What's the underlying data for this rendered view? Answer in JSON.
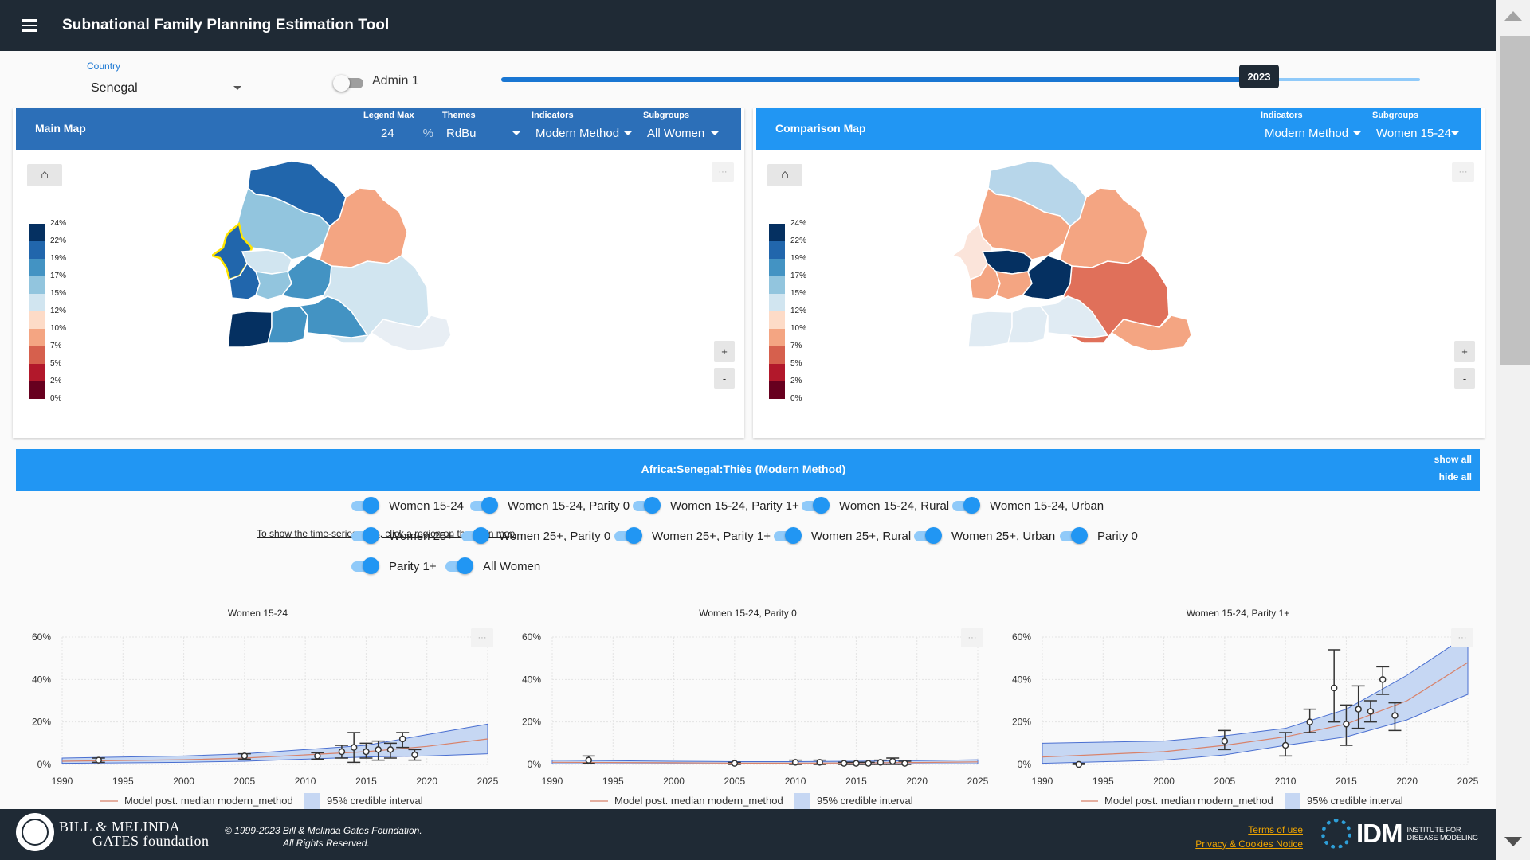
{
  "app": {
    "title": "Subnational Family Planning Estimation Tool"
  },
  "controls": {
    "country_label": "Country",
    "country_value": "Senegal",
    "admin_label": "Admin 1",
    "admin_on": false,
    "year": 2023,
    "year_label": "2023",
    "year_min": 1990,
    "year_max": 2030
  },
  "main_map": {
    "title": "Main Map",
    "legend_max_label": "Legend Max",
    "legend_max_value": "24",
    "legend_max_unit": "%",
    "themes_label": "Themes",
    "themes_value": "RdBu",
    "indicators_label": "Indicators",
    "indicators_value": "Modern Method",
    "subgroups_label": "Subgroups",
    "subgroups_value": "All Women",
    "note": "To show the time-series plots, click a region on the main map"
  },
  "comparison_map": {
    "title": "Comparison Map",
    "indicators_label": "Indicators",
    "indicators_value": "Modern Method",
    "subgroups_label": "Subgroups",
    "subgroups_value": "Women 15-24"
  },
  "legend": {
    "labels": [
      "24%",
      "22%",
      "19%",
      "17%",
      "15%",
      "12%",
      "10%",
      "7%",
      "5%",
      "2%",
      "0%"
    ],
    "colors": [
      "#053061",
      "#2166ac",
      "#4393c3",
      "#92c5de",
      "#d1e5f0",
      "#fddbc7",
      "#f4a582",
      "#d6604d",
      "#b2182b",
      "#67001f"
    ]
  },
  "map_buttons": {
    "home": "⌂",
    "dots": "···",
    "zoom_in": "+",
    "zoom_out": "-"
  },
  "region": {
    "title": "Africa:Senegal:Thiès (Modern Method)",
    "show_all": "show all",
    "hide_all": "hide all"
  },
  "subgroup_toggles": [
    "Women 15-24",
    "Women 15-24, Parity 0",
    "Women 15-24, Parity 1+",
    "Women 15-24, Rural",
    "Women 15-24, Urban",
    "Women 25+",
    "Women 25+, Parity 0",
    "Women 25+, Parity 1+",
    "Women 25+, Rural",
    "Women 25+, Urban",
    "Parity 0",
    "Parity 1+",
    "All Women"
  ],
  "chart_data": [
    {
      "type": "line",
      "title": "Women 15-24",
      "x_ticks": [
        "1990",
        "1995",
        "2000",
        "2005",
        "2010",
        "2015",
        "2020",
        "2025"
      ],
      "y_ticks": [
        "0%",
        "20%",
        "40%",
        "60%"
      ],
      "xlim": [
        1990,
        2025
      ],
      "ylim": [
        0,
        60
      ],
      "legend": {
        "median": "Model post. median modern_method",
        "interval": "95% credible interval"
      },
      "median": [
        [
          1990,
          1.5
        ],
        [
          2000,
          2.2
        ],
        [
          2005,
          3
        ],
        [
          2010,
          4.5
        ],
        [
          2015,
          6
        ],
        [
          2020,
          8.5
        ],
        [
          2025,
          12
        ]
      ],
      "interval": [
        [
          1990,
          0.5,
          3
        ],
        [
          2000,
          1,
          4
        ],
        [
          2005,
          1.5,
          5
        ],
        [
          2010,
          2.5,
          7
        ],
        [
          2015,
          3.5,
          9
        ],
        [
          2020,
          4,
          14
        ],
        [
          2025,
          5,
          19
        ]
      ],
      "observations": [
        [
          1993,
          2,
          1,
          3
        ],
        [
          2005,
          4,
          2.5,
          5
        ],
        [
          2011,
          4,
          2.5,
          5.5
        ],
        [
          2013,
          6,
          3,
          9
        ],
        [
          2014,
          8,
          1,
          15
        ],
        [
          2015,
          6,
          3,
          10
        ],
        [
          2016,
          7,
          2,
          11
        ],
        [
          2017,
          7,
          3,
          10
        ],
        [
          2018,
          12,
          8,
          15
        ],
        [
          2019,
          4.5,
          2,
          7
        ]
      ]
    },
    {
      "type": "line",
      "title": "Women 15-24, Parity 0",
      "x_ticks": [
        "1990",
        "1995",
        "2000",
        "2005",
        "2010",
        "2015",
        "2020",
        "2025"
      ],
      "y_ticks": [
        "0%",
        "20%",
        "40%",
        "60%"
      ],
      "xlim": [
        1990,
        2025
      ],
      "ylim": [
        0,
        60
      ],
      "legend": {
        "median": "Model post. median modern_method",
        "interval": "95% credible interval"
      },
      "median": [
        [
          1990,
          1
        ],
        [
          2000,
          0.8
        ],
        [
          2005,
          0.6
        ],
        [
          2010,
          0.6
        ],
        [
          2015,
          0.7
        ],
        [
          2020,
          0.9
        ],
        [
          2025,
          1.2
        ]
      ],
      "interval": [
        [
          1990,
          0.3,
          2
        ],
        [
          2000,
          0.3,
          1.5
        ],
        [
          2005,
          0.2,
          1.3
        ],
        [
          2010,
          0.2,
          1.3
        ],
        [
          2015,
          0.2,
          1.5
        ],
        [
          2020,
          0.3,
          1.8
        ],
        [
          2025,
          0.3,
          2.2
        ]
      ],
      "observations": [
        [
          1993,
          2,
          0.5,
          4
        ],
        [
          2005,
          0.5,
          0,
          1
        ],
        [
          2010,
          1,
          0,
          2
        ],
        [
          2012,
          1,
          0,
          2
        ],
        [
          2014,
          0.5,
          0,
          1
        ],
        [
          2015,
          0.5,
          0,
          1
        ],
        [
          2016,
          0.5,
          0,
          1
        ],
        [
          2017,
          1,
          0,
          2
        ],
        [
          2018,
          1.5,
          0,
          3
        ],
        [
          2019,
          0.5,
          0,
          1.5
        ]
      ]
    },
    {
      "type": "line",
      "title": "Women 15-24, Parity 1+",
      "x_ticks": [
        "1990",
        "1995",
        "2000",
        "2005",
        "2010",
        "2015",
        "2020",
        "2025"
      ],
      "y_ticks": [
        "0%",
        "20%",
        "40%",
        "60%"
      ],
      "xlim": [
        1990,
        2025
      ],
      "ylim": [
        0,
        60
      ],
      "legend": {
        "median": "Model post. median modern_method",
        "interval": "95% credible interval"
      },
      "median": [
        [
          1990,
          3.5
        ],
        [
          2000,
          6
        ],
        [
          2005,
          9
        ],
        [
          2010,
          13
        ],
        [
          2015,
          19
        ],
        [
          2020,
          30
        ],
        [
          2025,
          48
        ]
      ],
      "interval": [
        [
          1990,
          0.5,
          10
        ],
        [
          2000,
          2,
          11
        ],
        [
          2005,
          4.5,
          13.5
        ],
        [
          2010,
          9,
          17
        ],
        [
          2015,
          13,
          26
        ],
        [
          2020,
          21,
          42
        ],
        [
          2025,
          33,
          61
        ]
      ],
      "observations": [
        [
          1993,
          0,
          0,
          0.5
        ],
        [
          2005,
          11,
          7,
          16
        ],
        [
          2010,
          9,
          4,
          15
        ],
        [
          2012,
          20,
          15,
          26
        ],
        [
          2014,
          36,
          20,
          54
        ],
        [
          2015,
          19,
          9,
          28
        ],
        [
          2016,
          26,
          17,
          37
        ],
        [
          2017,
          25,
          20,
          30
        ],
        [
          2018,
          40,
          33,
          46
        ],
        [
          2019,
          23,
          16,
          29
        ]
      ]
    }
  ],
  "footer": {
    "org_line1": "BILL & MELINDA",
    "org_line2": "GATES foundation",
    "copyright_line1": "© 1999-2023 Bill & Melinda Gates Foundation.",
    "copyright_line2": "All Rights Reserved.",
    "terms": "Terms of use",
    "privacy": "Privacy & Cookies Notice",
    "idm_name": "IDM",
    "idm_sub1": "INSTITUTE FOR",
    "idm_sub2": "DISEASE MODELING"
  }
}
